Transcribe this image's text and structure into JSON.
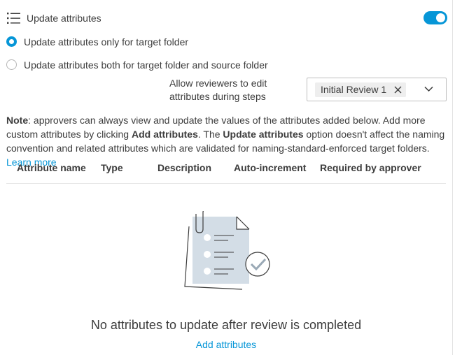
{
  "header": {
    "title": "Update attributes",
    "toggle_on": true,
    "accent_color": "#0696d7"
  },
  "options": [
    {
      "label": "Update attributes only for target folder",
      "checked": true
    },
    {
      "label": "Update attributes both for target folder and source folder",
      "checked": false
    }
  ],
  "reviewers": {
    "label_line1": "Allow reviewers to edit",
    "label_line2": "attributes during steps",
    "selected_chip": "Initial Review 1"
  },
  "note": {
    "lead": "Note",
    "part1": ": approvers can always view and update the values of the attributes added below. Add more custom attributes by clicking ",
    "bold1": "Add attributes",
    "part2": ". The ",
    "bold2": "Update attributes",
    "part3": " option doesn't affect the naming convention and related attributes which are validated for naming-standard-enforced target folders. ",
    "link": "Learn more"
  },
  "table": {
    "columns": [
      "Attribute name",
      "Type",
      "Description",
      "Auto-increment",
      "Required by approver"
    ]
  },
  "empty_state": {
    "title": "No attributes to update after review is completed",
    "action": "Add attributes"
  }
}
